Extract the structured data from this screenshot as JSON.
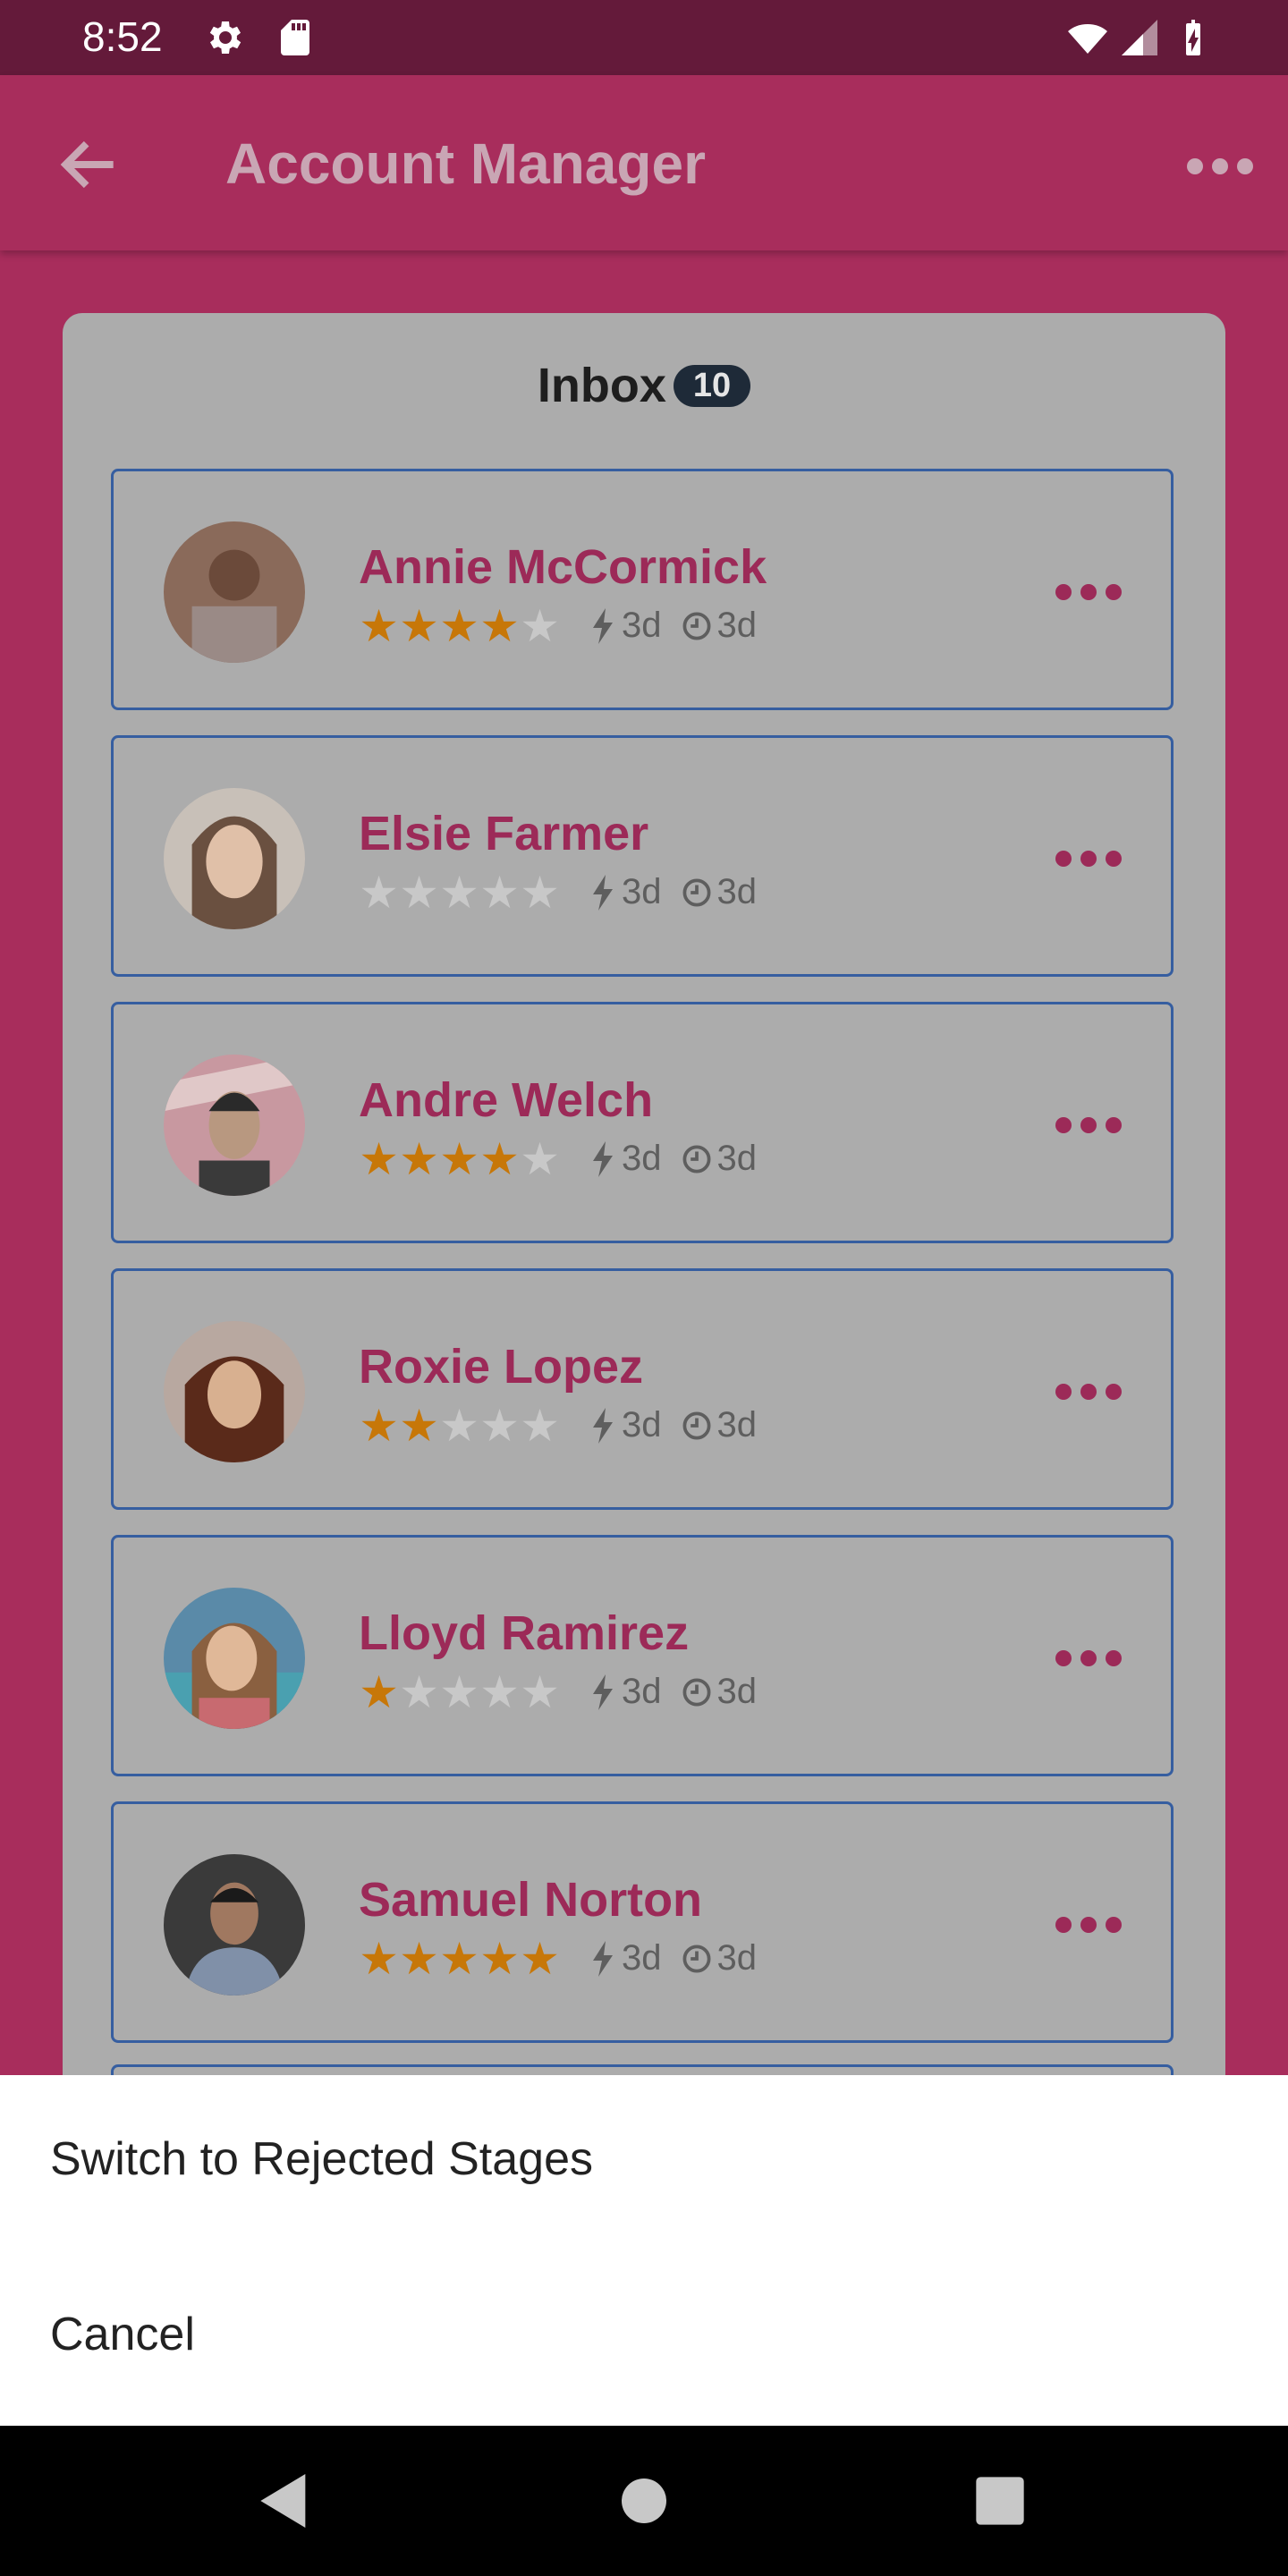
{
  "status_bar": {
    "time": "8:52"
  },
  "app_bar": {
    "title": "Account Manager"
  },
  "inbox": {
    "label": "Inbox",
    "count": "10",
    "contacts": [
      {
        "name": "Annie McCormick",
        "rating": 4,
        "lightning": "3d",
        "clock": "3d"
      },
      {
        "name": "Elsie Farmer",
        "rating": 0,
        "lightning": "3d",
        "clock": "3d"
      },
      {
        "name": "Andre Welch",
        "rating": 4,
        "lightning": "3d",
        "clock": "3d"
      },
      {
        "name": "Roxie Lopez",
        "rating": 2,
        "lightning": "3d",
        "clock": "3d"
      },
      {
        "name": "Lloyd Ramirez",
        "rating": 1,
        "lightning": "3d",
        "clock": "3d"
      },
      {
        "name": "Samuel Norton",
        "rating": 5,
        "lightning": "3d",
        "clock": "3d"
      }
    ]
  },
  "sheet": {
    "options": [
      "Switch to Rejected Stages",
      "Cancel"
    ]
  },
  "colors": {
    "accent": "#a82d5c",
    "name_text": "#9c2a58",
    "star_on": "#c77708",
    "border": "#365ea0"
  }
}
